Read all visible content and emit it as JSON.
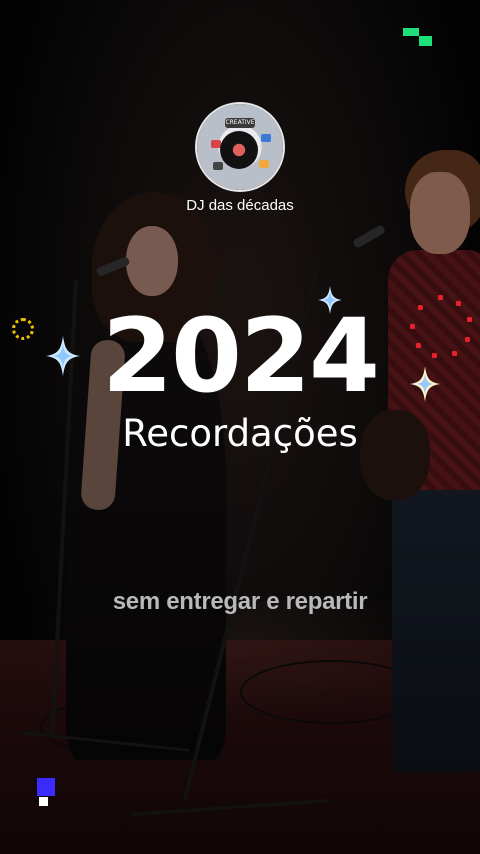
{
  "profile": {
    "username": "DJ das décadas",
    "avatar_icon": "dj-mixer-collage-icon"
  },
  "title": {
    "year": "2024",
    "subtitle": "Recordações"
  },
  "caption": "sem entregar e repartir",
  "colors": {
    "accent_green": "#1ee07a",
    "accent_red": "#e5212a",
    "accent_yellow": "#f2c400",
    "accent_blue": "#3b2bff",
    "caption_gray": "#b9b9b9"
  },
  "decorations": [
    "sparkle-icon",
    "red-dot-ring-icon",
    "yellow-dot-ring-icon",
    "pixel-squares-icon"
  ]
}
